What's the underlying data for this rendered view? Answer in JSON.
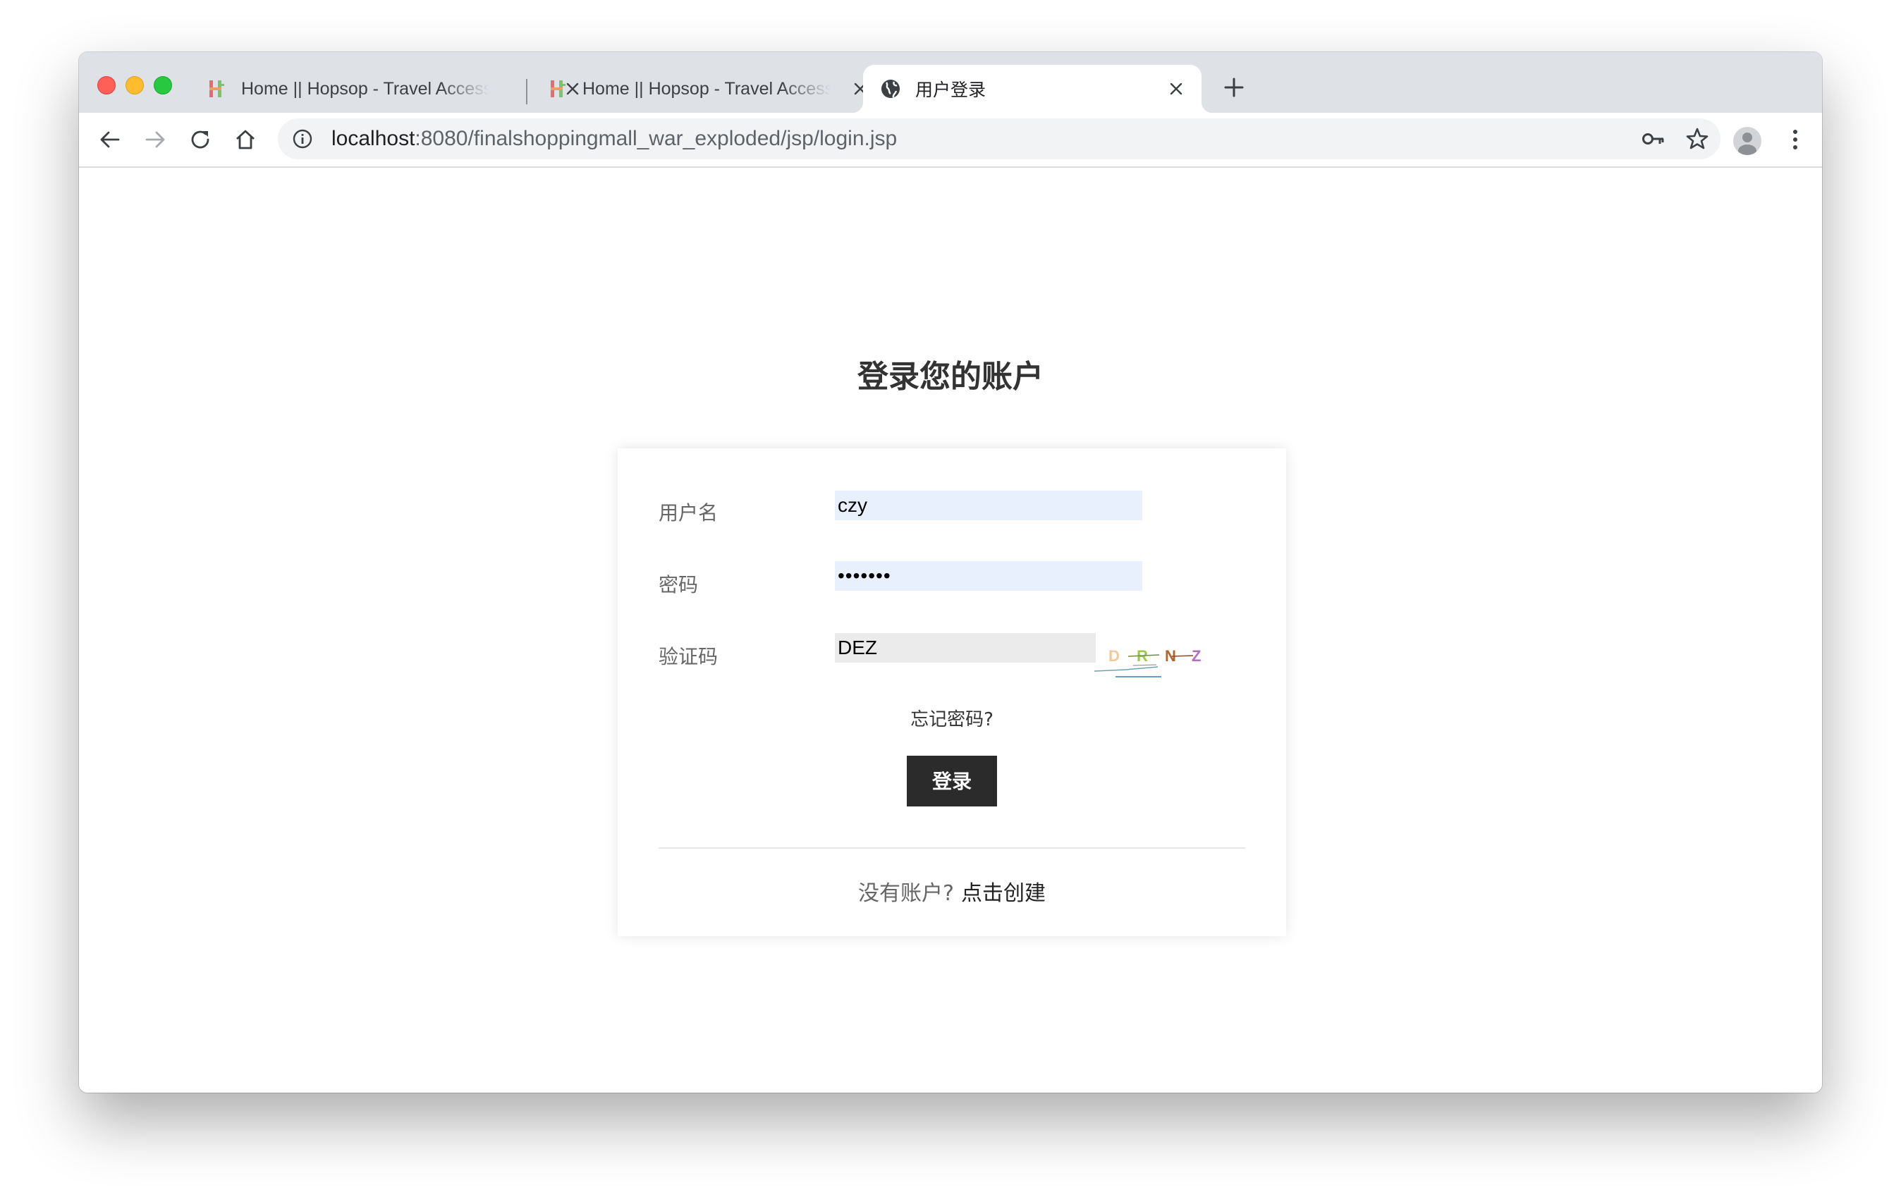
{
  "browser": {
    "tabs": [
      {
        "title": "Home || Hopsop - Travel Accessories",
        "icon": "hopsop-favicon"
      },
      {
        "title": "Home || Hopsop - Travel Accessories",
        "icon": "hopsop-favicon"
      },
      {
        "title": "用户登录",
        "icon": "globe-icon",
        "active": true
      }
    ],
    "url_host": "localhost",
    "url_rest": ":8080/finalshoppingmall_war_exploded/jsp/login.jsp"
  },
  "login": {
    "heading": "登录您的账户",
    "username_label": "用户名",
    "username_value": "czy",
    "password_label": "密码",
    "password_value": "•••••••",
    "captcha_label": "验证码",
    "captcha_value": "DEZ",
    "captcha_chars": [
      "D",
      "R",
      "N",
      "Z"
    ],
    "forgot_label": "忘记密码?",
    "submit_label": "登录",
    "no_account_text": "没有账户?",
    "create_link": "点击创建"
  },
  "colors": {
    "button": "#2b2b2b",
    "autofill": "#e8f0fe",
    "tabstrip": "#dee1e6"
  }
}
